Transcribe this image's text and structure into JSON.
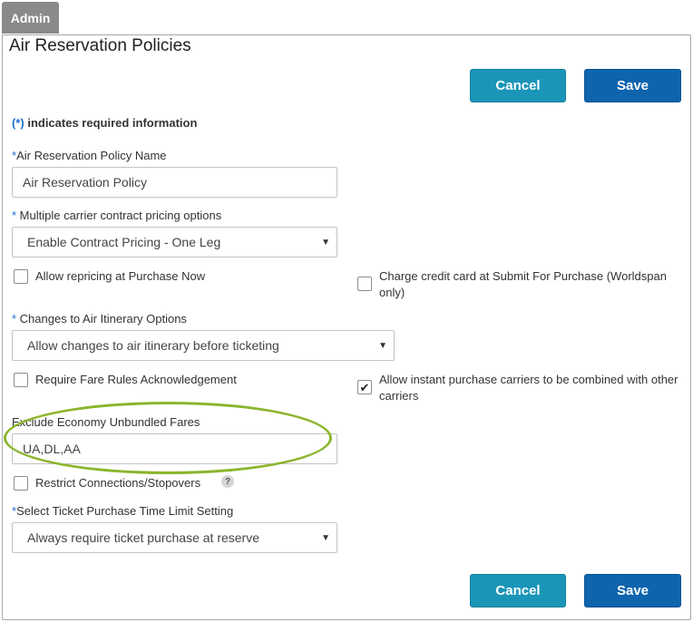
{
  "header": {
    "admin_tab": "Admin",
    "page_title": "Air Reservation Policies"
  },
  "buttons": {
    "cancel": "Cancel",
    "save": "Save"
  },
  "required_note": {
    "star": "(*)",
    "text": " indicates required information"
  },
  "fields": {
    "policy_name": {
      "required_marker": "*",
      "label": "Air Reservation Policy Name",
      "value": "Air Reservation Policy"
    },
    "carrier_pricing": {
      "required_marker": "* ",
      "label": "Multiple carrier contract pricing options",
      "value": "Enable Contract Pricing - One Leg"
    },
    "itinerary_options": {
      "required_marker": "* ",
      "label": "Changes to Air Itinerary Options",
      "value": "Allow changes to air itinerary before ticketing"
    },
    "exclude_fares": {
      "label": "Exclude Economy Unbundled Fares",
      "value": "UA,DL,AA"
    },
    "ticket_time_limit": {
      "required_marker": "*",
      "label": "Select Ticket Purchase Time Limit Setting",
      "value": "Always require ticket purchase at reserve"
    }
  },
  "checkboxes": {
    "allow_repricing": {
      "label": "Allow repricing at Purchase Now",
      "checked": false
    },
    "charge_card": {
      "label": "Charge credit card at Submit For Purchase (Worldspan only)",
      "checked": false
    },
    "fare_rules_ack": {
      "label": "Require Fare Rules Acknowledgement",
      "checked": false
    },
    "instant_purchase": {
      "label": "Allow instant purchase carriers to be combined with other carriers",
      "checked": true
    },
    "restrict_connections": {
      "label": "Restrict Connections/Stopovers",
      "checked": false
    }
  },
  "icons": {
    "help": "?",
    "caret": "▼",
    "check": "✔"
  },
  "colors": {
    "cancel": "#1b95b7",
    "save": "#0e64ad",
    "required": "#1a6fd0",
    "highlight": "#8bb52d"
  }
}
